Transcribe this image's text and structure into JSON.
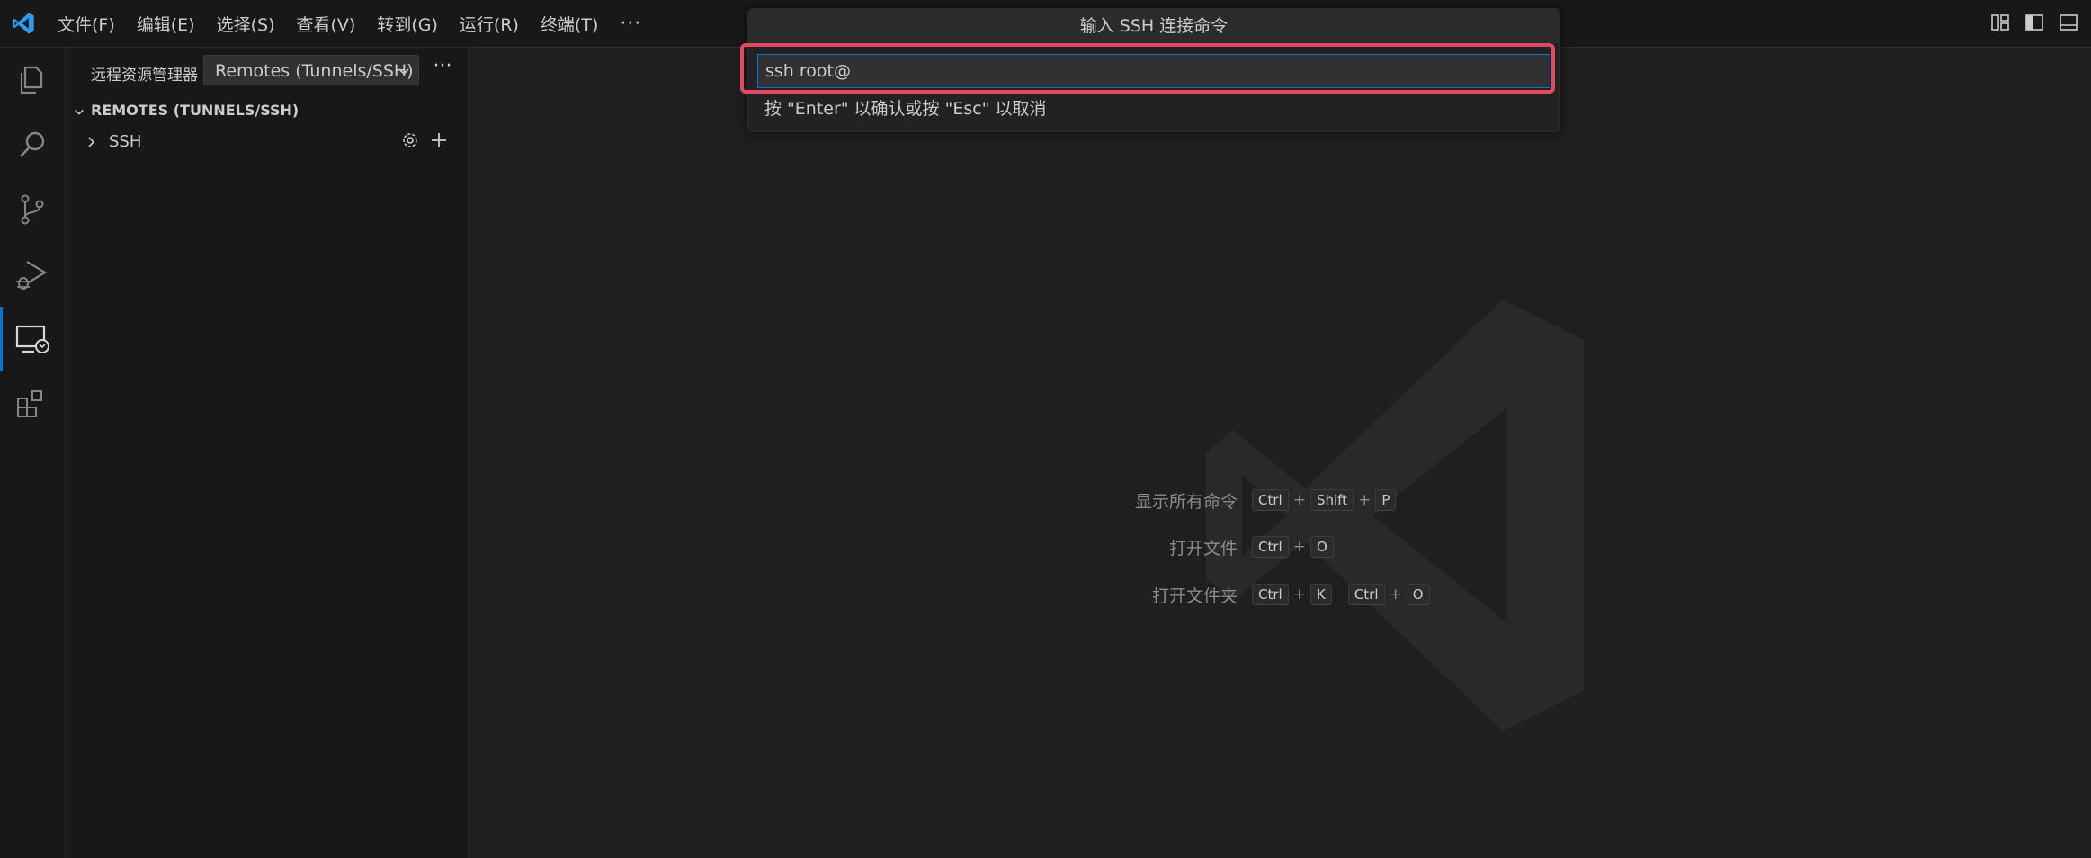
{
  "menu": {
    "items": [
      "文件(F)",
      "编辑(E)",
      "选择(S)",
      "查看(V)",
      "转到(G)",
      "运行(R)",
      "终端(T)"
    ],
    "more": "···"
  },
  "sidebar": {
    "title": "远程资源管理器",
    "dropdown_value": "Remotes (Tunnels/SSH)",
    "more": "···",
    "section_title": "REMOTES (TUNNELS/SSH)",
    "tree": [
      {
        "label": "SSH"
      }
    ]
  },
  "quick_input": {
    "title": "输入 SSH 连接命令",
    "value": "ssh root@",
    "hint": "按 \"Enter\" 以确认或按 \"Esc\" 以取消"
  },
  "shortcuts": [
    {
      "label": "显示所有命令",
      "keys": [
        "Ctrl",
        "+",
        "Shift",
        "+",
        "P"
      ]
    },
    {
      "label": "打开文件",
      "keys": [
        "Ctrl",
        "+",
        "O"
      ]
    },
    {
      "label": "打开文件夹",
      "keys": [
        "Ctrl",
        "+",
        "K",
        " ",
        "Ctrl",
        "+",
        "O"
      ]
    }
  ],
  "colors": {
    "accent": "#0078d4",
    "highlight": "#e2485f",
    "background": "#1f1f1f"
  },
  "icons": {
    "activity": [
      "explorer-icon",
      "search-icon",
      "source-control-icon",
      "run-debug-icon",
      "remote-explorer-icon",
      "extensions-icon"
    ]
  }
}
